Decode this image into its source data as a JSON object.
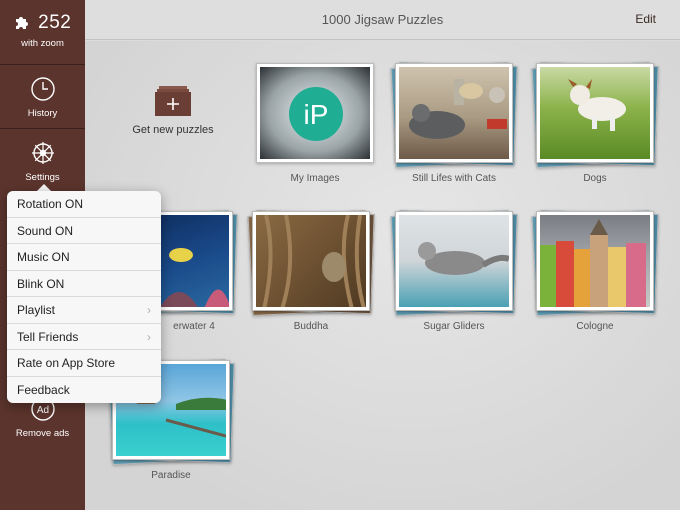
{
  "sidebar": {
    "count": "252",
    "count_sub": "with zoom",
    "history_label": "History",
    "settings_label": "Settings",
    "remove_ads_label": "Remove ads"
  },
  "header": {
    "title": "1000 Jigsaw Puzzles",
    "edit_label": "Edit"
  },
  "main": {
    "get_new_label": "Get new puzzles",
    "albums": [
      {
        "title": "My Images"
      },
      {
        "title": "Still Lifes with Cats"
      },
      {
        "title": "Dogs"
      },
      {
        "title": "erwater 4"
      },
      {
        "title": "Buddha"
      },
      {
        "title": "Sugar Gliders"
      },
      {
        "title": "Cologne"
      },
      {
        "title": "Paradise"
      }
    ]
  },
  "menu": {
    "items": [
      {
        "label": "Rotation ON"
      },
      {
        "label": "Sound ON"
      },
      {
        "label": "Music ON"
      },
      {
        "label": "Blink ON"
      },
      {
        "label": "Playlist"
      },
      {
        "label": "Tell Friends"
      },
      {
        "label": "Rate on App Store"
      },
      {
        "label": "Feedback"
      }
    ]
  },
  "icons": {
    "puzzle": "puzzle-piece-icon",
    "history": "clock-icon",
    "settings": "ship-wheel-icon",
    "remove_ads": "ad-icon",
    "add": "plus-box-icon"
  },
  "colors": {
    "sidebar_bg": "#5b342d",
    "accent_box": "#6a3e35"
  }
}
